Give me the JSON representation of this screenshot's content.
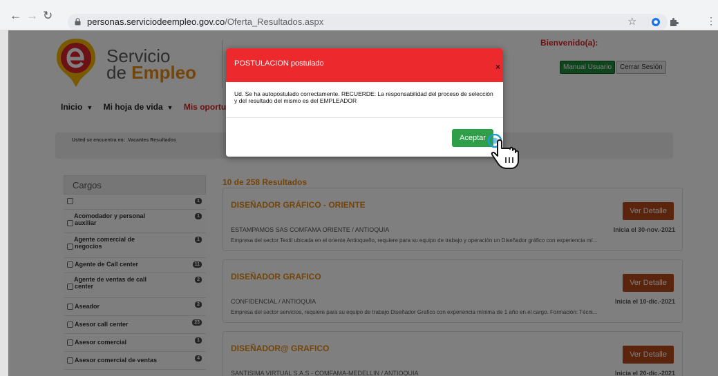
{
  "browser": {
    "url_host": "personas.serviciodeempleo.gov.co",
    "url_path": "/Oferta_Resultados.aspx",
    "icons": [
      "back-arrow-icon",
      "forward-arrow-icon",
      "reload-icon",
      "lock-icon",
      "star-icon",
      "extension-icon",
      "puzzle-icon",
      "menu-dots-icon"
    ]
  },
  "header": {
    "logo_line1": "Servicio",
    "logo_line2_prefix": "de ",
    "logo_line2_bold": "Empleo",
    "welcome": "Bienvenido(a):",
    "manual_button": "Manual Usuario",
    "logout_button": "Cerrar Sesión"
  },
  "nav": {
    "items": [
      "Inicio",
      "Mi hoja de vida",
      "Mis oportuni"
    ]
  },
  "breadcrumb": {
    "label": "Usted se encuentra en:",
    "current": "Vacantes Resultados"
  },
  "sidebar": {
    "title": "Cargos",
    "items": [
      {
        "label": "",
        "count": "1"
      },
      {
        "label": "Acomodador y personal auxiliar",
        "line1": "Acomodador y personal",
        "line2": "auxiliar",
        "count": "1"
      },
      {
        "label": "Agente comercial de negocios",
        "line1": "Agente comercial de",
        "line2": "negocios",
        "count": "1"
      },
      {
        "label": "Agente de Call center",
        "count": "11"
      },
      {
        "label": "Agente de ventas de call center",
        "line1": "Agente de ventas de call",
        "line2": "center",
        "count": "2"
      },
      {
        "label": "Aseador",
        "count": "2"
      },
      {
        "label": "Asesor call center",
        "count": "23"
      },
      {
        "label": "Asesor comercial",
        "count": "1"
      },
      {
        "label": "Asesor comercial de ventas",
        "count": "4"
      }
    ]
  },
  "results": {
    "count_text": "10 de 258 Resultados",
    "detail_label": "Ver Detalle",
    "items": [
      {
        "title": "DISEÑADOR GRÁFICO - ORIENTE",
        "company": "ESTAMPAMOS SAS COMFAMA ORIENTE / ANTIOQUIA",
        "date": "Inicia el 30-nov.-2021",
        "description": "Empresa del sector Textil ubicada en el oriente Antioqueño, requiere para su equipo de trabajo y operación un Diseñador gráfico con experiencia mí..."
      },
      {
        "title": "DISEÑADOR GRAFICO",
        "company": "CONFIDENCIAL / ANTIOQUIA",
        "date": "Inicia el 10-dic.-2021",
        "description": "Empresa del sector servicios, requiere para su equipo de trabajo Diseñador Grafico con experiencia mínima de 1 año en el cargo. Formación: Técni..."
      },
      {
        "title": "DISEÑADOR@ GRAFICO",
        "company": "SANTISIMA VIRTUAL S.A.S - COMFAMA-MEDELLIN / ANTIOQUIA",
        "date": "Inicia el 20-dic.-2021",
        "description": ""
      }
    ]
  },
  "modal": {
    "title": "POSTULACION postulado",
    "close": "×",
    "message": "Ud. Se ha autopostulado correctamente. RECUERDE: La responsabilidad del proceso de selección y del resultado del mismo es del EMPLEADOR",
    "accept_button": "Aceptar"
  },
  "colors": {
    "modal_header": "#ec2a2e",
    "accept_button": "#2e9e49",
    "accent_orange": "#e98a13",
    "detail_button": "#b5481a"
  }
}
